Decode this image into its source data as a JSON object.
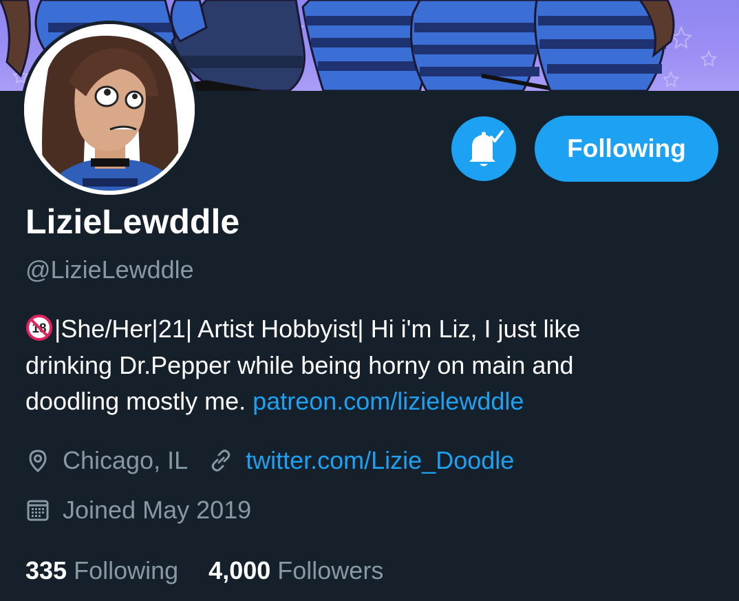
{
  "profile": {
    "display_name": "LizieLewddle",
    "handle": "@LizieLewddle"
  },
  "actions": {
    "follow_label": "Following"
  },
  "bio": {
    "line1": "|She/Her|21| Artist Hobbyist| Hi i'm Liz, I just like",
    "line2": "drinking Dr.Pepper while being horny on main and",
    "line3_text": "doodling mostly me.",
    "line3_link": "patreon.com/lizielewddle"
  },
  "meta": {
    "location": "Chicago, IL",
    "website": "twitter.com/Lizie_Doodle",
    "joined": "Joined May 2019"
  },
  "stats": {
    "following_count": "335",
    "following_label": "Following",
    "followers_count": "4,000",
    "followers_label": "Followers"
  },
  "icons": {
    "notification": "bell-check-icon",
    "location": "location-pin-icon",
    "website": "link-icon",
    "joined": "calendar-icon",
    "age_badge": "no-under-18-icon"
  },
  "colors": {
    "background": "#15202b",
    "accent": "#1da1f2",
    "secondary_text": "#8899a6",
    "primary_text": "#ffffff",
    "banner": "#9b8ff4"
  }
}
